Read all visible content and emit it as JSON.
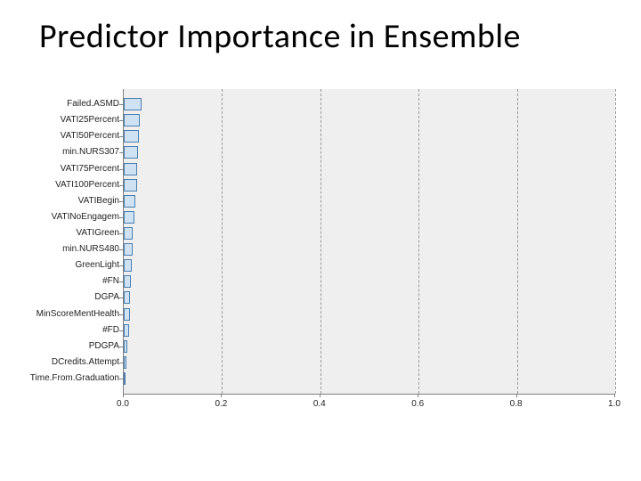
{
  "title": "Predictor Importance in Ensemble",
  "chart_data": {
    "type": "bar",
    "orientation": "horizontal",
    "xlabel": "",
    "ylabel": "",
    "xlim": [
      0.0,
      1.0
    ],
    "x_ticks": [
      0.0,
      0.2,
      0.4,
      0.6,
      0.8,
      1.0
    ],
    "x_tick_labels": [
      "0.0",
      "0.2",
      "0.4",
      "0.6",
      "0.8",
      "1.0"
    ],
    "categories": [
      "Failed.ASMD",
      "VATI25Percent",
      "VATI50Percent",
      "min.NURS307",
      "VATI75Percent",
      "VATI100Percent",
      "VATIBegin",
      "VATINoEngagem",
      "VATIGreen",
      "min.NURS480",
      "GreenLight",
      "#FN",
      "DGPA",
      "MinScoreMentHealth",
      "#FD",
      "PDGPA",
      "DCredits.Attempt",
      "Time.From.Graduation"
    ],
    "values": [
      0.037,
      0.032,
      0.03,
      0.029,
      0.028,
      0.027,
      0.023,
      0.021,
      0.019,
      0.018,
      0.017,
      0.014,
      0.013,
      0.012,
      0.01,
      0.008,
      0.005,
      0.004
    ],
    "colors": {
      "bar_fill": "#cfe2f3",
      "bar_edge": "#4a7fb0",
      "plot_bg": "#efefef"
    }
  }
}
